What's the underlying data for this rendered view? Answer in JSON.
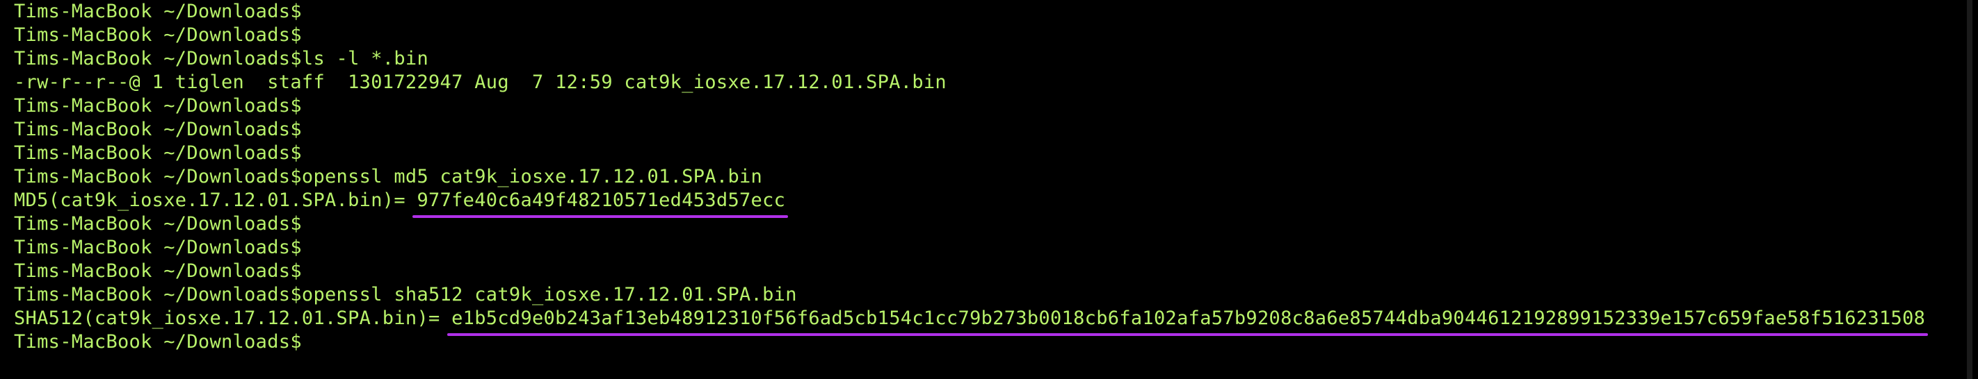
{
  "terminal": {
    "prompt": "Tims-MacBook ~/Downloads$",
    "underline_color": "#b030e8",
    "text_color": "#b8f26a",
    "background_color": "#000000",
    "lines": [
      {
        "prompt": "Tims-MacBook ~/Downloads$",
        "text": ""
      },
      {
        "prompt": "Tims-MacBook ~/Downloads$",
        "text": ""
      },
      {
        "prompt": "Tims-MacBook ~/Downloads$",
        "text": "ls -l *.bin"
      },
      {
        "prompt": "",
        "text": "-rw-r--r--@ 1 tiglen  staff  1301722947 Aug  7 12:59 cat9k_iosxe.17.12.01.SPA.bin"
      },
      {
        "prompt": "Tims-MacBook ~/Downloads$",
        "text": ""
      },
      {
        "prompt": "Tims-MacBook ~/Downloads$",
        "text": ""
      },
      {
        "prompt": "Tims-MacBook ~/Downloads$",
        "text": ""
      },
      {
        "prompt": "Tims-MacBook ~/Downloads$",
        "text": "openssl md5 cat9k_iosxe.17.12.01.SPA.bin"
      },
      {
        "prompt": "",
        "text": "MD5(cat9k_iosxe.17.12.01.SPA.bin)= ",
        "hash": "977fe40c6a49f48210571ed453d57ecc"
      },
      {
        "prompt": "Tims-MacBook ~/Downloads$",
        "text": ""
      },
      {
        "prompt": "Tims-MacBook ~/Downloads$",
        "text": ""
      },
      {
        "prompt": "Tims-MacBook ~/Downloads$",
        "text": ""
      },
      {
        "prompt": "Tims-MacBook ~/Downloads$",
        "text": "openssl sha512 cat9k_iosxe.17.12.01.SPA.bin"
      },
      {
        "prompt": "",
        "text": "SHA512(cat9k_iosxe.17.12.01.SPA.bin)= ",
        "hash": "e1b5cd9e0b243af13eb48912310f56f6ad5cb154c1cc79b273b0018cb6fa102afa57b9208c8a6e85744dba9044612192899152339e157c659fae58f516231508"
      },
      {
        "prompt": "Tims-MacBook ~/Downloads$",
        "text": ""
      }
    ]
  }
}
